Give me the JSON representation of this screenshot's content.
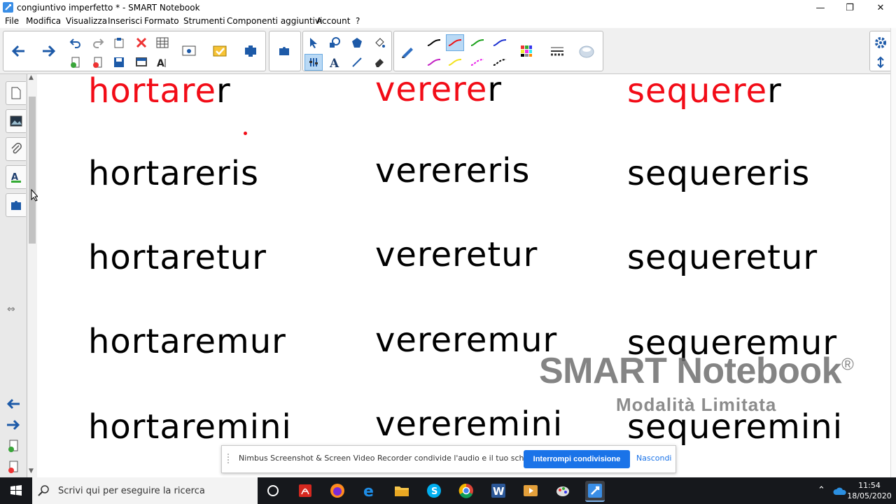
{
  "window": {
    "title": "congiuntivo imperfetto * - SMART Notebook",
    "minimize": "—",
    "restore": "❐",
    "close": "✕"
  },
  "menu": [
    "File",
    "Modifica",
    "Visualizza",
    "Inserisci",
    "Formato",
    "Strumenti",
    "Componenti aggiuntivi",
    "Account",
    "?"
  ],
  "canvas": {
    "columns": [
      {
        "rows": [
          {
            "red": "hortare",
            "black": "r"
          },
          {
            "black": "hortareris"
          },
          {
            "black": "hortaretur"
          },
          {
            "black": "hortaremur"
          },
          {
            "black": "hortaremini"
          }
        ]
      },
      {
        "rows": [
          {
            "red": "verere",
            "black": "r"
          },
          {
            "black": "verereris"
          },
          {
            "black": "vereretur"
          },
          {
            "black": "vereremur"
          },
          {
            "black": "vereremini"
          }
        ]
      },
      {
        "rows": [
          {
            "red": "sequere",
            "black": "r"
          },
          {
            "black": "sequereris"
          },
          {
            "black": "sequeretur"
          },
          {
            "black": "sequeremur"
          },
          {
            "black": "sequeremini"
          }
        ]
      }
    ],
    "accent_red": "#f20c17"
  },
  "watermark": {
    "brand": "SMART Notebook",
    "reg": "®",
    "mode": "Modalità Limitata"
  },
  "notification": {
    "message": "Nimbus Screenshot & Screen Video Recorder condivide l'audio e il tuo schermo.",
    "stop_label": "Interrompi condivisione",
    "hide_label": "Nascondi"
  },
  "taskbar": {
    "search_placeholder": "Scrivi qui per eseguire la ricerca",
    "time": "11:54",
    "date": "18/05/2020",
    "apps": [
      "cortana-icon",
      "acrobat-icon",
      "firefox-icon",
      "edge-icon",
      "file-explorer-icon",
      "skype-icon",
      "chrome-icon",
      "word-icon",
      "video-icon",
      "paint-icon",
      "smart-notebook-icon"
    ]
  }
}
